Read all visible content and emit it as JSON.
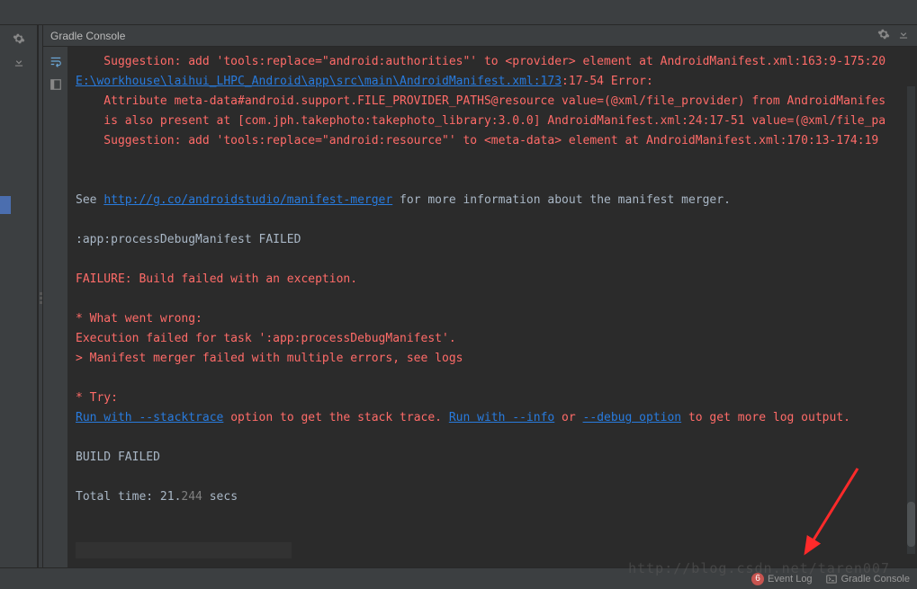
{
  "header": {
    "title": "Gradle Console"
  },
  "console": {
    "line1_prefix": "    Suggestion: add 'tools:replace=\"android:authorities\"' to <provider> element at AndroidManifest.xml:163:9-175:20",
    "line2_path": "E:\\workhouse\\laihui_LHPC_Android\\app\\src\\main\\AndroidManifest.xml:173",
    "line2_rest": ":17-54 Error:",
    "line3": "    Attribute meta-data#android.support.FILE_PROVIDER_PATHS@resource value=(@xml/file_provider) from AndroidManifes",
    "line4": "    is also present at [com.jph.takephoto:takephoto_library:3.0.0] AndroidManifest.xml:24:17-51 value=(@xml/file_pa",
    "line5": "    Suggestion: add 'tools:replace=\"android:resource\"' to <meta-data> element at AndroidManifest.xml:170:13-174:19 ",
    "see_prefix": "See ",
    "see_link": "http://g.co/androidstudio/manifest-merger",
    "see_suffix": " for more information about the manifest merger.",
    "task_failed": ":app:processDebugManifest FAILED",
    "failure_line": "FAILURE: Build failed with an exception.",
    "what_wrong": "* What went wrong:",
    "exec_failed": "Execution failed for task ':app:processDebugManifest'.",
    "merger_failed": "> Manifest merger failed with multiple errors, see logs",
    "try_label": "* Try:",
    "run_stack": "Run with --stacktrace",
    "stack_suffix": " option to get the stack trace. ",
    "run_info": "Run with --info",
    "or_text": " or ",
    "debug_opt": "--debug option",
    "debug_suffix": " to get more log output.",
    "build_failed": "BUILD FAILED",
    "total_time_pre": "Total time: 21.",
    "total_time_ms": "244",
    "total_time_post": " secs"
  },
  "status": {
    "event_count": "6",
    "event_log": "Event Log",
    "gradle_console": "Gradle Console"
  },
  "watermark": "http://blog.csdn.net/taren007"
}
